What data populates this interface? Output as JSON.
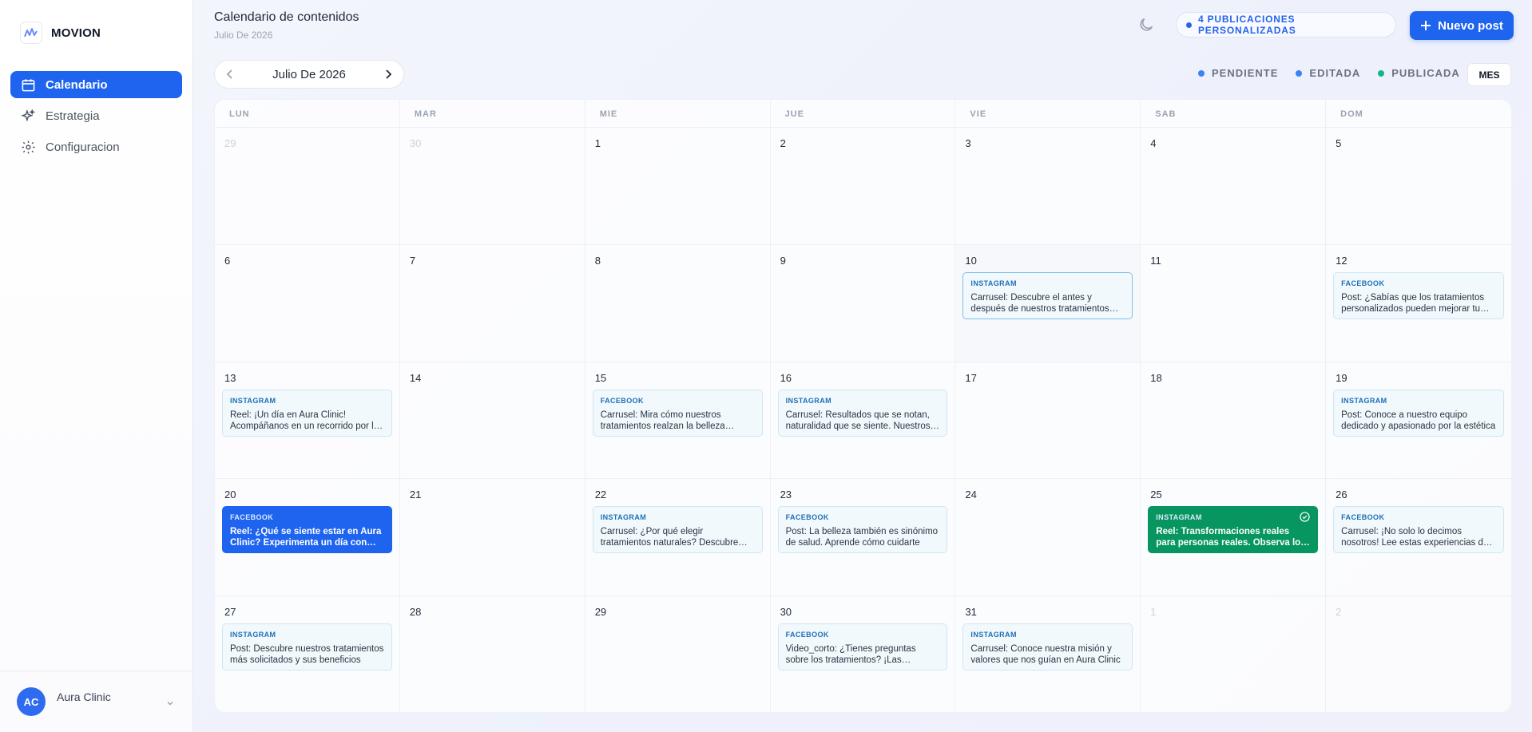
{
  "brand": {
    "name": "MOVION"
  },
  "sidebar": {
    "items": [
      {
        "label": "Calendario",
        "icon": "calendar-icon",
        "active": true
      },
      {
        "label": "Estrategia",
        "icon": "sparkles-icon",
        "active": false
      },
      {
        "label": "Configuracion",
        "icon": "gear-icon",
        "active": false
      }
    ]
  },
  "profile": {
    "initials": "AC",
    "name": "Aura Clinic"
  },
  "header": {
    "title": "Calendario de contenidos",
    "subtitle": "Julio De 2026",
    "pill": "4 PUBLICACIONES PERSONALIZADAS",
    "new_post": "Nuevo post"
  },
  "toolbar": {
    "month": "Julio De 2026",
    "legend": [
      {
        "label": "PENDIENTE",
        "color": "#3b82f6"
      },
      {
        "label": "EDITADA",
        "color": "#3b82f6"
      },
      {
        "label": "PUBLICADA",
        "color": "#10b981"
      }
    ],
    "view": "MES"
  },
  "calendar": {
    "weekdays": [
      "LUN",
      "MAR",
      "MIE",
      "JUE",
      "VIE",
      "SAB",
      "DOM"
    ],
    "days": [
      {
        "num": "29",
        "muted": true
      },
      {
        "num": "30",
        "muted": true
      },
      {
        "num": "1"
      },
      {
        "num": "2"
      },
      {
        "num": "3"
      },
      {
        "num": "4"
      },
      {
        "num": "5"
      },
      {
        "num": "6"
      },
      {
        "num": "7"
      },
      {
        "num": "8"
      },
      {
        "num": "9"
      },
      {
        "num": "10",
        "today": true,
        "post": {
          "channel": "INSTAGRAM",
          "text": "Carrusel: Descubre el antes y después de nuestros tratamientos faciales",
          "status": "selected"
        }
      },
      {
        "num": "11"
      },
      {
        "num": "12",
        "post": {
          "channel": "FACEBOOK",
          "text": "Post: ¿Sabías que los tratamientos personalizados pueden mejorar tu piel?"
        }
      },
      {
        "num": "13",
        "post": {
          "channel": "INSTAGRAM",
          "text": "Reel: ¡Un día en Aura Clinic! Acompáñanos en un recorrido por la clínica"
        }
      },
      {
        "num": "14"
      },
      {
        "num": "15",
        "post": {
          "channel": "FACEBOOK",
          "text": "Carrusel: Mira cómo nuestros tratamientos realzan la belleza natural"
        }
      },
      {
        "num": "16",
        "post": {
          "channel": "INSTAGRAM",
          "text": "Carrusel: Resultados que se notan, naturalidad que se siente. Nuestros casos"
        }
      },
      {
        "num": "17"
      },
      {
        "num": "18"
      },
      {
        "num": "19",
        "post": {
          "channel": "INSTAGRAM",
          "text": "Post: Conoce a nuestro equipo dedicado y apasionado por la estética"
        }
      },
      {
        "num": "20",
        "post": {
          "channel": "FACEBOOK",
          "text": "Reel: ¿Qué se siente estar en Aura Clinic? Experimenta un día con nosotros",
          "status": "edited"
        }
      },
      {
        "num": "21"
      },
      {
        "num": "22",
        "post": {
          "channel": "INSTAGRAM",
          "text": "Carrusel: ¿Por qué elegir tratamientos naturales? Descubre sus beneficios"
        }
      },
      {
        "num": "23",
        "post": {
          "channel": "FACEBOOK",
          "text": "Post: La belleza también es sinónimo de salud. Aprende cómo cuidarte"
        }
      },
      {
        "num": "24"
      },
      {
        "num": "25",
        "post": {
          "channel": "INSTAGRAM",
          "text": "Reel: Transformaciones reales para personas reales. Observa los resultados",
          "status": "published"
        }
      },
      {
        "num": "26",
        "post": {
          "channel": "FACEBOOK",
          "text": "Carrusel: ¡No solo lo decimos nosotros! Lee estas experiencias de clientes"
        }
      },
      {
        "num": "27",
        "post": {
          "channel": "INSTAGRAM",
          "text": "Post: Descubre nuestros tratamientos más solicitados y sus beneficios"
        }
      },
      {
        "num": "28"
      },
      {
        "num": "29"
      },
      {
        "num": "30",
        "post": {
          "channel": "FACEBOOK",
          "text": "Video_corto: ¿Tienes preguntas sobre los tratamientos? ¡Las respondemos!"
        }
      },
      {
        "num": "31",
        "post": {
          "channel": "INSTAGRAM",
          "text": "Carrusel: Conoce nuestra misión y valores que nos guían en Aura Clinic"
        }
      },
      {
        "num": "1",
        "muted": true
      },
      {
        "num": "2",
        "muted": true
      }
    ]
  }
}
